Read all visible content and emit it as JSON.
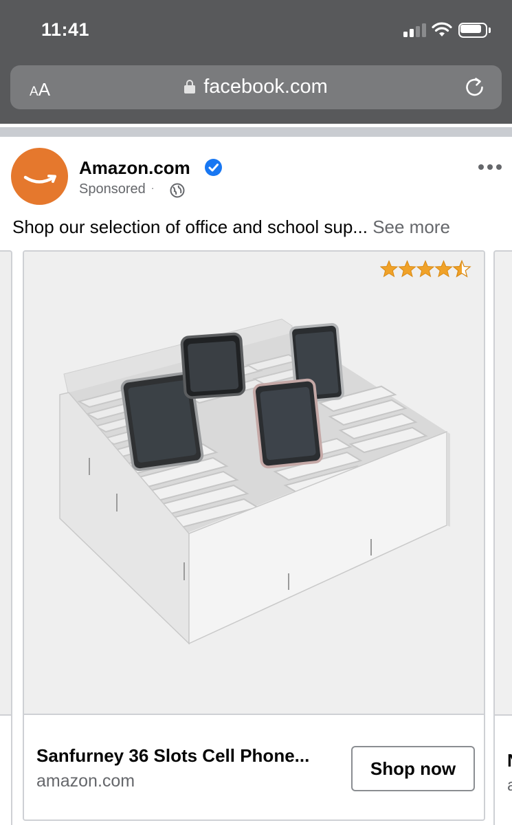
{
  "status_bar": {
    "time": "11:41",
    "icons": [
      "cellular-signal-icon",
      "wifi-icon",
      "battery-icon"
    ]
  },
  "browser": {
    "text_size_label_small": "A",
    "text_size_label_large": "A",
    "domain": "facebook.com",
    "icons": [
      "lock-icon",
      "reload-icon"
    ]
  },
  "post": {
    "page_name": "Amazon.com",
    "sponsored_label": "Sponsored",
    "separator": "·",
    "caption": "Shop our selection of office and school sup...",
    "see_more": " See more",
    "icons": [
      "amazon-logo-icon",
      "verified-badge-icon",
      "globe-icon",
      "more-options-icon"
    ]
  },
  "carousel": {
    "current_card": {
      "rating_stars": 4.5,
      "rating_max": 5,
      "title": "Sanfurney 36 Slots Cell Phone...",
      "domain": "amazon.com",
      "cta_label": "Shop now"
    },
    "next_card_peek": {
      "title_fragment": "N",
      "domain_fragment": "a"
    }
  },
  "colors": {
    "chrome_bg": "#58595b",
    "urlbar_bg": "#7a7b7d",
    "amazon_orange": "#e5782d",
    "verified_blue": "#1877f2",
    "star_gold": "#f0a229",
    "secondary_text": "#65676b"
  }
}
